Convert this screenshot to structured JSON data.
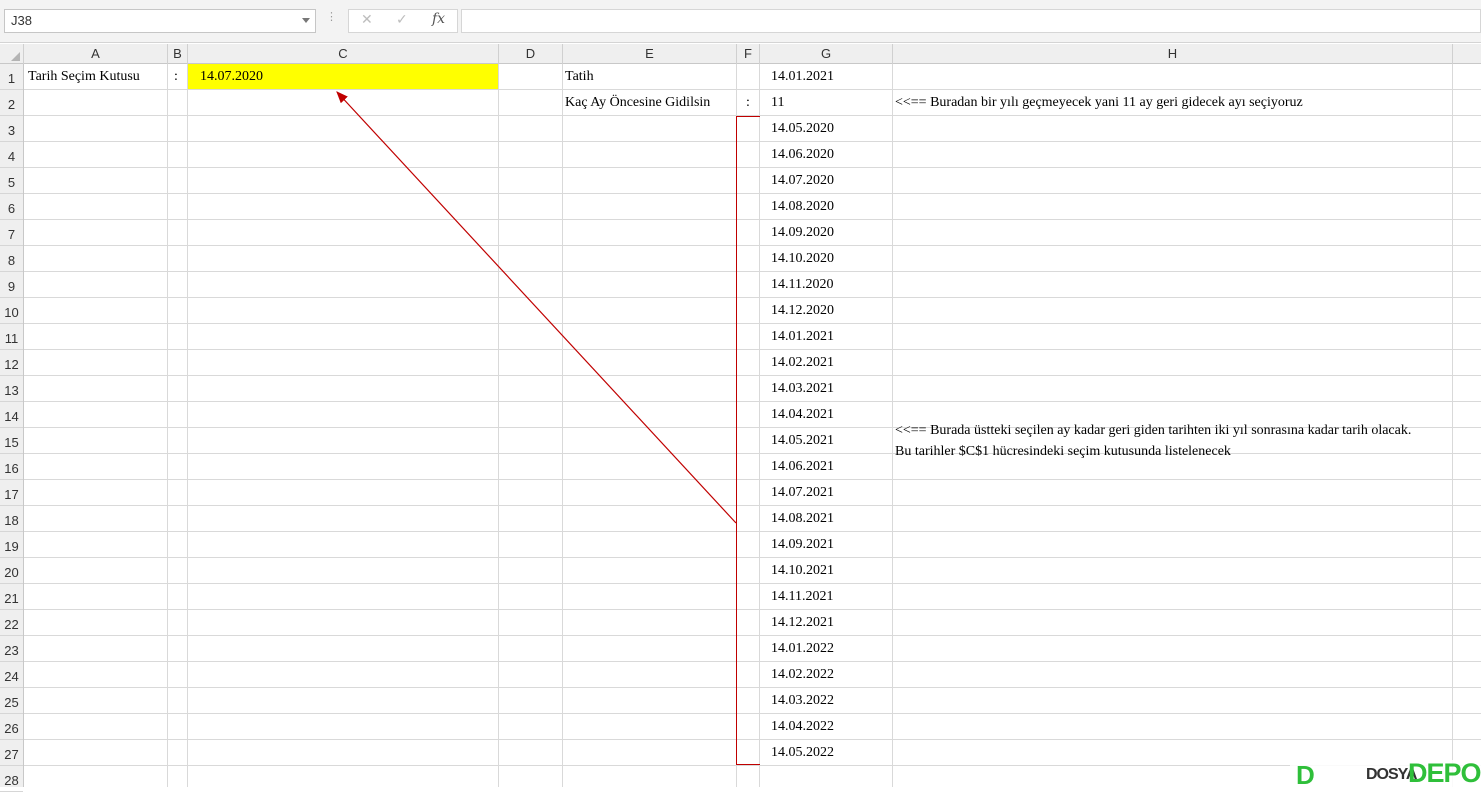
{
  "formula_bar": {
    "name_box": "J38",
    "fx_label": "fx",
    "formula_value": "",
    "dots": "⋮",
    "cancel_symbol": "✕",
    "enter_symbol": "✓"
  },
  "columns": [
    "A",
    "B",
    "C",
    "D",
    "E",
    "F",
    "G",
    "H"
  ],
  "rows": [
    "1",
    "2",
    "3",
    "4",
    "5",
    "6",
    "7",
    "8",
    "9",
    "10",
    "11",
    "12",
    "13",
    "14",
    "15",
    "16",
    "17",
    "18",
    "19",
    "20",
    "21",
    "22",
    "23",
    "24",
    "25",
    "26",
    "27",
    "28"
  ],
  "cells": {
    "A1": "Tarih Seçim Kutusu",
    "B1": ":",
    "C1": "14.07.2020",
    "E1": "Tatih",
    "G1": "14.01.2021",
    "E2": "Kaç Ay Öncesine Gidilsin",
    "F2": ":",
    "G2": "11",
    "H2": "<<== Buradan bir yılı geçmeyecek yani 11 ay geri gidecek ayı seçiyoruz"
  },
  "date_list": [
    "14.05.2020",
    "14.06.2020",
    "14.07.2020",
    "14.08.2020",
    "14.09.2020",
    "14.10.2020",
    "14.11.2020",
    "14.12.2020",
    "14.01.2021",
    "14.02.2021",
    "14.03.2021",
    "14.04.2021",
    "14.05.2021",
    "14.06.2021",
    "14.07.2021",
    "14.08.2021",
    "14.09.2021",
    "14.10.2021",
    "14.11.2021",
    "14.12.2021",
    "14.01.2022",
    "14.02.2022",
    "14.03.2022",
    "14.04.2022",
    "14.05.2022"
  ],
  "note_h14": {
    "line1": "<<== Burada üstteki seçilen ay kadar geri giden tarihten iki yıl sonrasına kadar tarih olacak.",
    "line2": "Bu tarihler $C$1 hücresindeki seçim kutusunda listelenecek"
  },
  "colors": {
    "highlight": "#ffff00",
    "annotation": "#c00000",
    "brand": "#2fbf3a"
  },
  "watermark": {
    "d": "D",
    "text": "DOSYA",
    "depo": "DEPO"
  }
}
